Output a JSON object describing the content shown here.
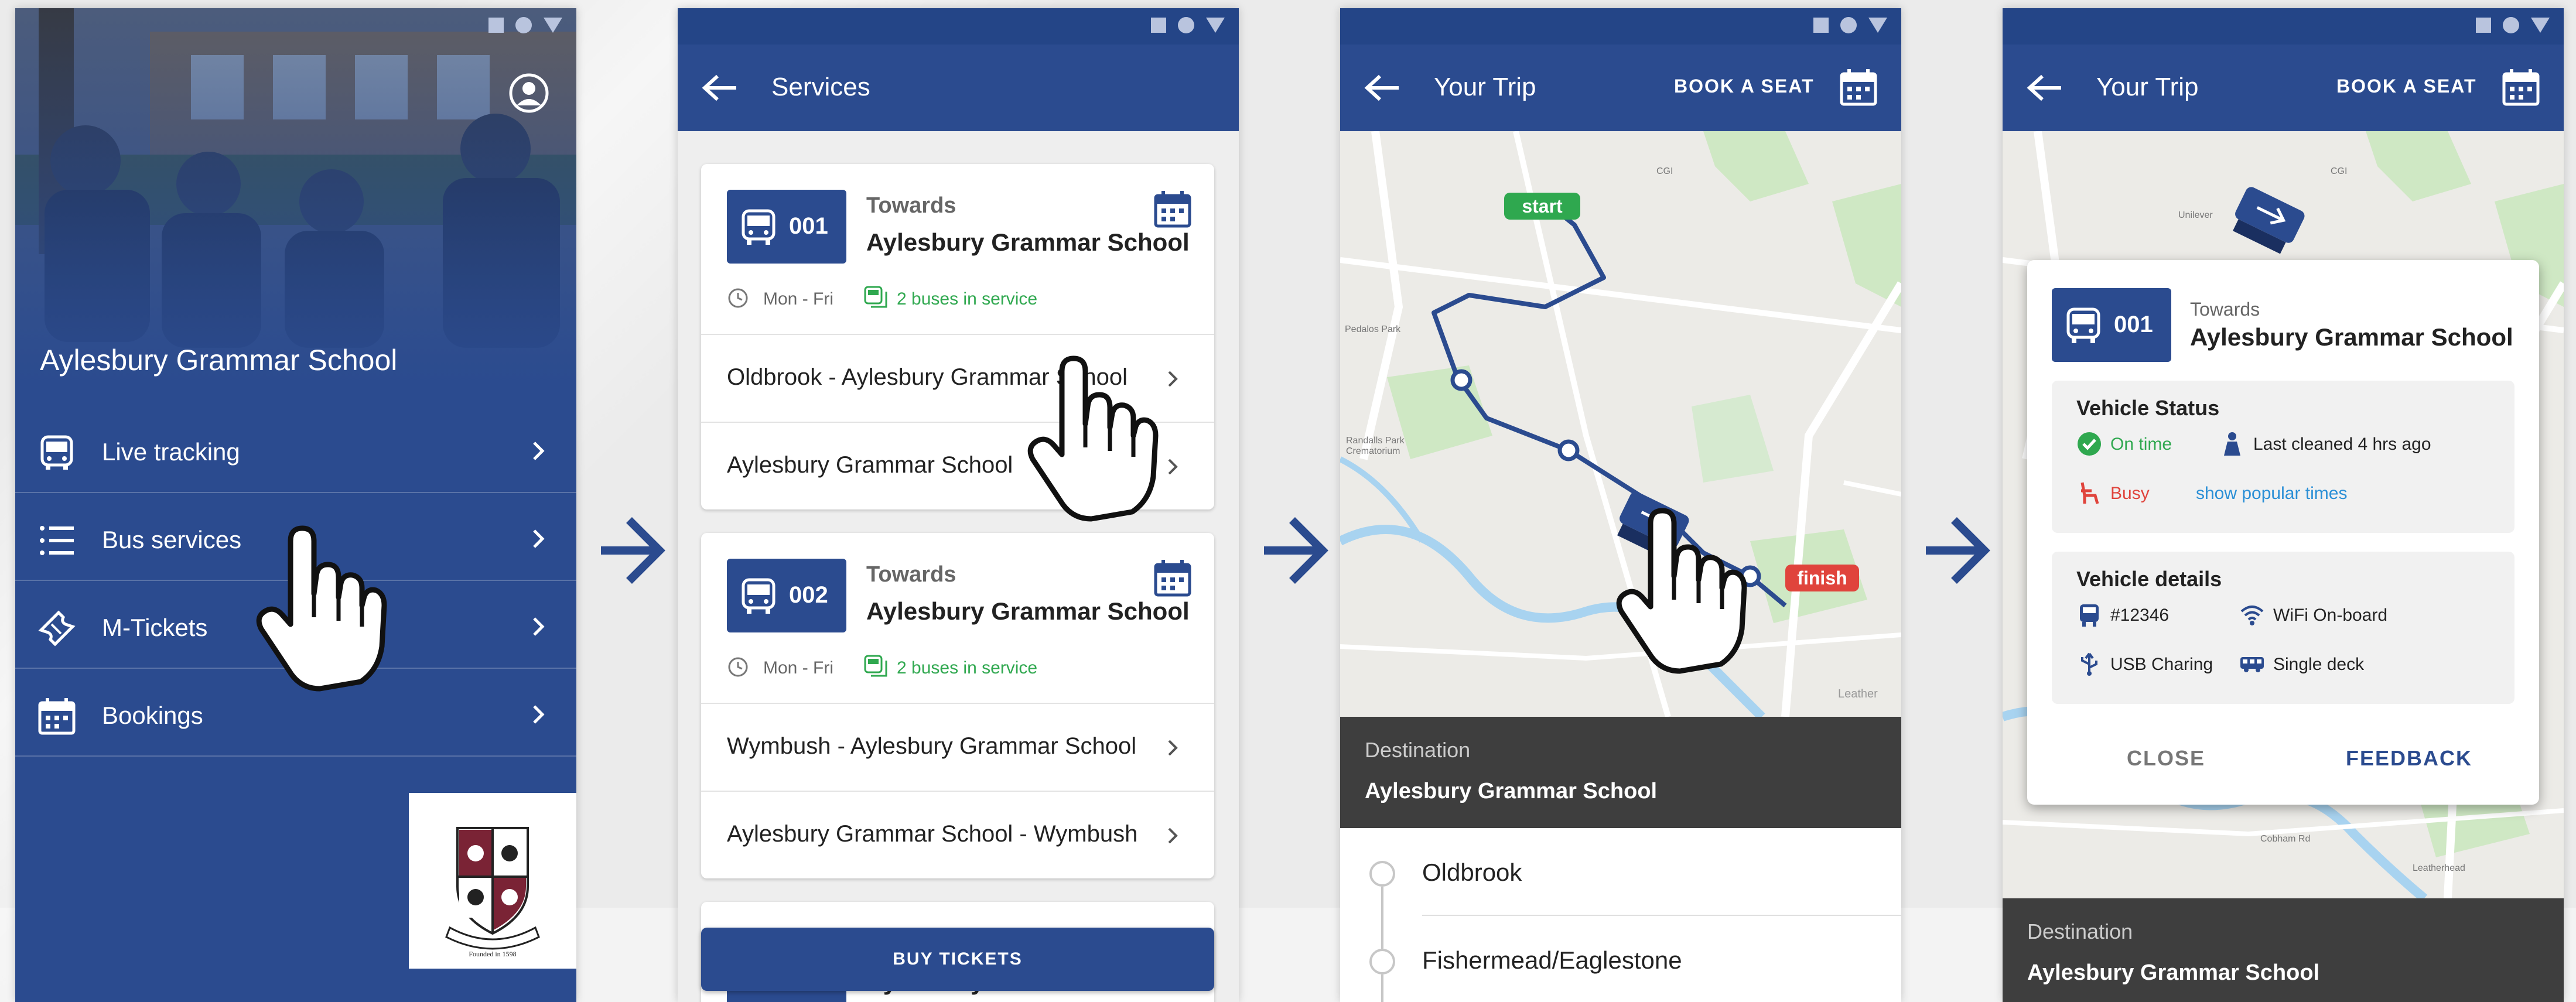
{
  "screens": {
    "home": {
      "school_name": "Aylesbury Grammar School",
      "menu": [
        {
          "label": "Live tracking",
          "icon": "bus-icon"
        },
        {
          "label": "Bus services",
          "icon": "list-icon"
        },
        {
          "label": "M-Tickets",
          "icon": "ticket-icon"
        },
        {
          "label": "Bookings",
          "icon": "calendar-icon"
        }
      ],
      "crest_motto": "Founded in 1598"
    },
    "services": {
      "title": "Services",
      "cards": [
        {
          "route": "001",
          "towards_label": "Towards",
          "destination": "Aylesbury Grammar School",
          "days": "Mon - Fri",
          "in_service": "2 buses in service",
          "rows": [
            "Oldbrook - Aylesbury Grammar School",
            "Aylesbury Grammar School"
          ]
        },
        {
          "route": "002",
          "towards_label": "Towards",
          "destination": "Aylesbury Grammar School",
          "days": "Mon - Fri",
          "in_service": "2 buses in service",
          "rows": [
            "Wymbush - Aylesbury Grammar School",
            "Aylesbury Grammar School - Wymbush"
          ]
        }
      ],
      "peek_text": "Aylesbury Grammar School",
      "buy_button": "BUY TICKETS"
    },
    "trip": {
      "title": "Your Trip",
      "book_seat": "BOOK A SEAT",
      "start_label": "start",
      "finish_label": "finish",
      "map_labels": [
        "CGI",
        "Pedalos Park",
        "Randalls Park Crematorium",
        "Leather"
      ],
      "destination_label": "Destination",
      "destination_value": "Aylesbury Grammar School",
      "stops": [
        "Oldbrook",
        "Fishermead/Eaglestone"
      ]
    },
    "vehicle": {
      "title": "Your Trip",
      "book_seat": "BOOK A SEAT",
      "map_labels": [
        "CGI",
        "Unilever",
        "Leatherhead",
        "Cobham Rd"
      ],
      "route": "001",
      "towards_label": "Towards",
      "destination": "Aylesbury Grammar School",
      "status_title": "Vehicle Status",
      "on_time": "On time",
      "last_cleaned": "Last cleaned 4 hrs ago",
      "busy": "Busy",
      "popular_times": "show popular times",
      "details_title": "Vehicle details",
      "vehicle_id": "#12346",
      "wifi": "WiFi On-board",
      "usb": "USB Charing",
      "deck": "Single deck",
      "close": "CLOSE",
      "feedback": "FEEDBACK",
      "destination_label": "Destination",
      "destination_value": "Aylesbury Grammar School"
    }
  },
  "colors": {
    "primary": "#2b4b8f",
    "status_bar": "#244587",
    "green": "#2fa84f",
    "red": "#e0443c",
    "link": "#2a8fd6",
    "dark_panel": "#3e3e3e"
  }
}
